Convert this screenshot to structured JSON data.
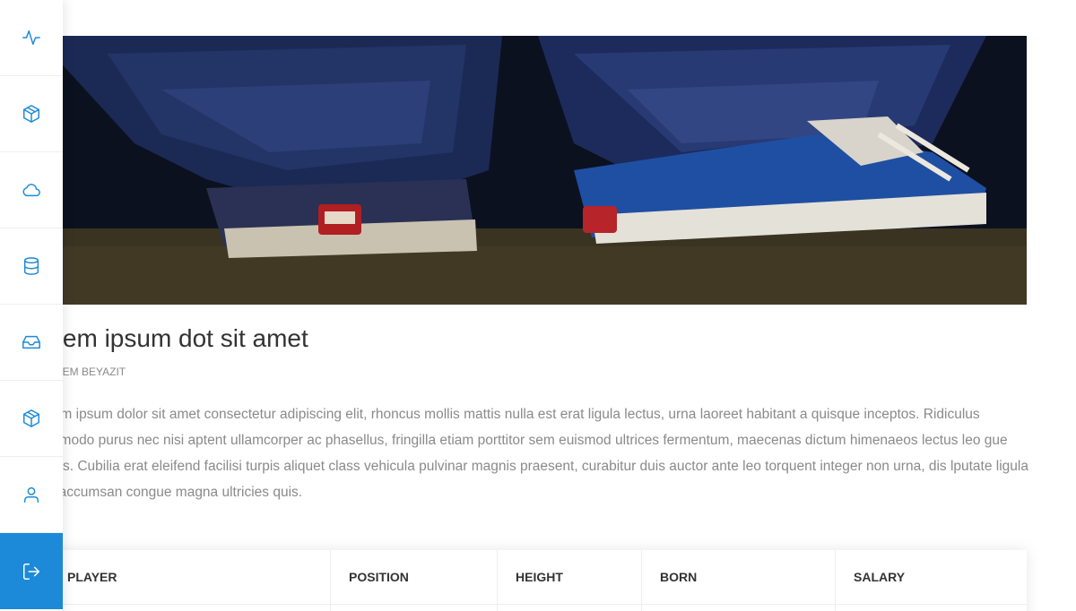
{
  "sidebar": {
    "items": [
      {
        "icon": "activity-icon"
      },
      {
        "icon": "box-icon"
      },
      {
        "icon": "cloud-icon"
      },
      {
        "icon": "database-icon"
      },
      {
        "icon": "inbox-icon"
      },
      {
        "icon": "box-icon"
      },
      {
        "icon": "user-icon"
      },
      {
        "icon": "log-out-icon",
        "active": true
      }
    ],
    "accent_color": "#1c8ad8"
  },
  "article": {
    "title": "orem ipsum dot sit amet",
    "author": "KEREM BEYAZIT",
    "body": "orem ipsum dolor sit amet consectetur adipiscing elit, rhoncus mollis mattis nulla est erat ligula lectus, urna laoreet habitant a quisque inceptos. Ridiculus ommodo purus nec nisi aptent ullamcorper ac phasellus, fringilla etiam porttitor sem euismod ultrices fermentum, maecenas dictum himenaeos lectus leo gue risus. Cubilia erat eleifend facilisi turpis aliquet class vehicula pulvinar magnis praesent, curabitur duis auctor ante leo torquent integer non urna, dis lputate ligula ac accumsan congue magna ultricies quis."
  },
  "table": {
    "columns": [
      "PLAYER",
      "POSITION",
      "HEIGHT",
      "BORN",
      "SALARY"
    ]
  }
}
